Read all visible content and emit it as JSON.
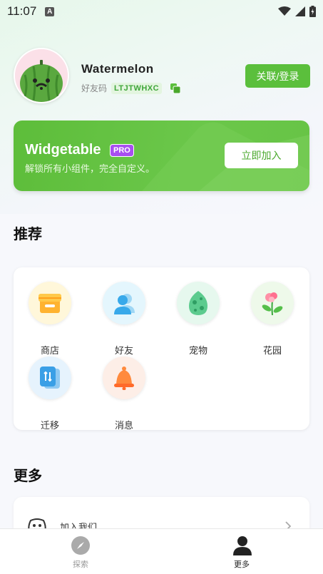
{
  "status_bar": {
    "time": "11:07",
    "indicator": "A"
  },
  "profile": {
    "username": "Watermelon",
    "friend_code_label": "好友码",
    "friend_code": "LTJTWHXC",
    "link_login_label": "关联/登录"
  },
  "pro_banner": {
    "title": "Widgetable",
    "badge": "PRO",
    "subtitle": "解锁所有小组件，完全自定义。",
    "cta_label": "立即加入"
  },
  "recommend": {
    "title": "推荐",
    "items": [
      {
        "label": "商店",
        "icon": "shop-icon"
      },
      {
        "label": "好友",
        "icon": "friends-icon"
      },
      {
        "label": "宠物",
        "icon": "pet-egg-icon"
      },
      {
        "label": "花园",
        "icon": "garden-flower-icon"
      },
      {
        "label": "迁移",
        "icon": "migrate-icon"
      },
      {
        "label": "消息",
        "icon": "bell-icon"
      }
    ]
  },
  "more": {
    "title": "更多",
    "items": [
      {
        "label": "加入我们",
        "icon": "discord-icon"
      }
    ]
  },
  "bottom_nav": {
    "items": [
      {
        "label": "探索",
        "icon": "compass-icon",
        "active": false
      },
      {
        "label": "更多",
        "icon": "person-icon",
        "active": true
      }
    ]
  },
  "colors": {
    "brand_green": "#5bbf3c",
    "pro_badge": "#a84ff0",
    "friend_code_text": "#3fa63a"
  }
}
